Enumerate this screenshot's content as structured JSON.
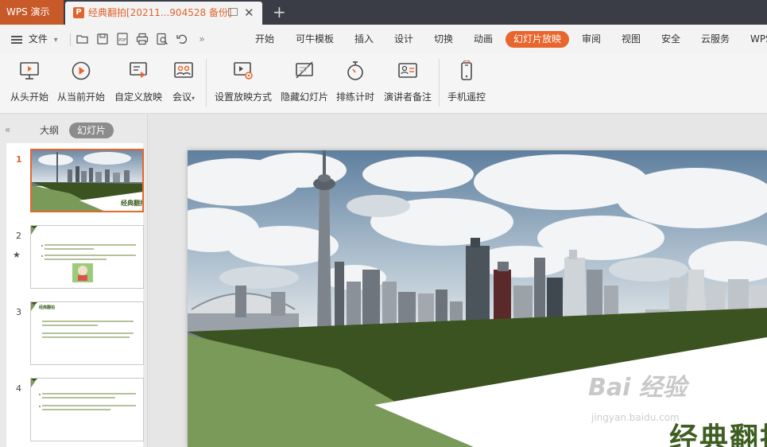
{
  "titlebar": {
    "app_name": "WPS 演示",
    "doc_tab_title": "经典翻拍[20211...904528 备份]",
    "doc_icon_letter": "P"
  },
  "menubar": {
    "file_label": "文件",
    "tabs": [
      "开始",
      "可牛模板",
      "插入",
      "设计",
      "切换",
      "动画",
      "幻灯片放映",
      "审阅",
      "视图",
      "安全",
      "云服务",
      "WPS"
    ],
    "active_tab": "幻灯片放映",
    "accent_color": "#e8662e"
  },
  "ribbon": {
    "buttons": [
      "从头开始",
      "从当前开始",
      "自定义放映",
      "会议",
      "设置放映方式",
      "隐藏幻灯片",
      "排练计时",
      "演讲者备注",
      "手机遥控"
    ]
  },
  "leftpanel": {
    "tab_outline": "大纲",
    "tab_slides": "幻灯片",
    "slide_numbers": [
      "1",
      "2",
      "3",
      "4"
    ],
    "thumb1_title": "经典翻拍",
    "thumb3_heading": "经典翻拍"
  },
  "slide": {
    "title": "经典翻拍",
    "colors": {
      "dark_green": "#3b5320",
      "light_green": "#7a9a5a",
      "title_green": "#3e5e22"
    }
  },
  "watermark": {
    "text": "Bai 经验",
    "url": "jingyan.baidu.com"
  }
}
